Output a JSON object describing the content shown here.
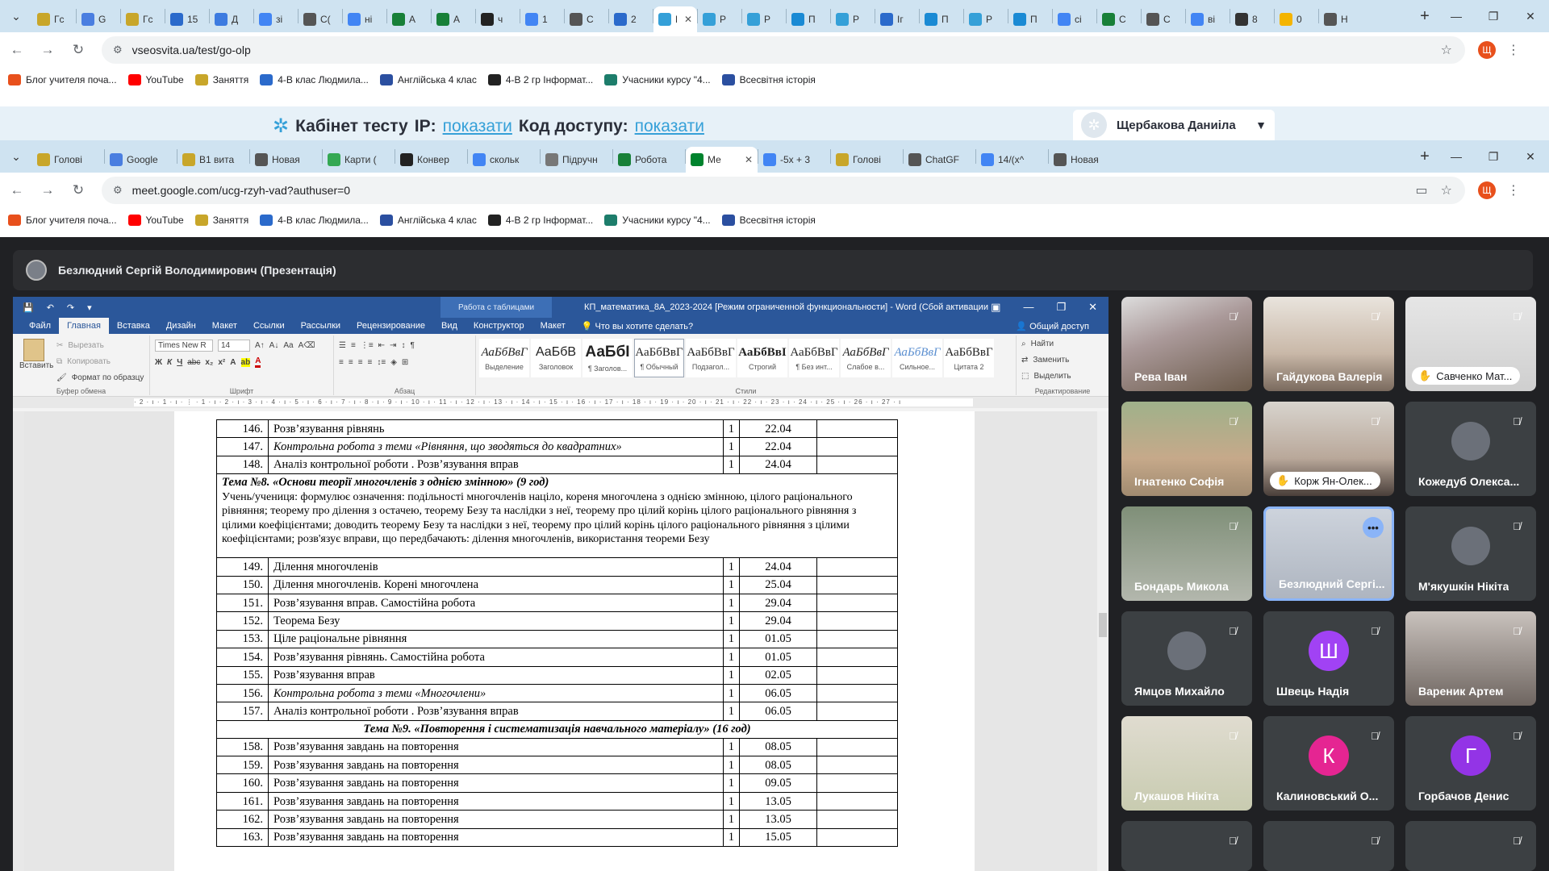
{
  "browser1": {
    "tabs": [
      {
        "label": "Гс",
        "color": "#c8a62a"
      },
      {
        "label": "G",
        "color": "#4a7ee0"
      },
      {
        "label": "Гс",
        "color": "#c8a62a"
      },
      {
        "label": "15",
        "color": "#2b6acb"
      },
      {
        "label": "Д",
        "color": "#3d7be0"
      },
      {
        "label": "зі",
        "color": "#4285f4"
      },
      {
        "label": "C(",
        "color": "#555"
      },
      {
        "label": "ні",
        "color": "#4285f4"
      },
      {
        "label": "А",
        "color": "#188038"
      },
      {
        "label": "А",
        "color": "#188038"
      },
      {
        "label": "ч",
        "color": "#222"
      },
      {
        "label": "1",
        "color": "#4285f4"
      },
      {
        "label": "C",
        "color": "#555"
      },
      {
        "label": "2",
        "color": "#2b6acb"
      },
      {
        "label": "П",
        "color": "#35a0d8",
        "active": true
      },
      {
        "label": "Р",
        "color": "#35a0d8"
      },
      {
        "label": "Р",
        "color": "#35a0d8"
      },
      {
        "label": "П",
        "color": "#1a8ad4"
      },
      {
        "label": "Р",
        "color": "#35a0d8"
      },
      {
        "label": "Іг",
        "color": "#2b6acb"
      },
      {
        "label": "П",
        "color": "#1a8ad4"
      },
      {
        "label": "Р",
        "color": "#35a0d8"
      },
      {
        "label": "П",
        "color": "#1a8ad4"
      },
      {
        "label": "сі",
        "color": "#4285f4"
      },
      {
        "label": "С",
        "color": "#188038"
      },
      {
        "label": "С",
        "color": "#555"
      },
      {
        "label": "ві",
        "color": "#4285f4"
      },
      {
        "label": "8",
        "color": "#333"
      },
      {
        "label": "0",
        "color": "#f4b400"
      },
      {
        "label": "Н",
        "color": "#555"
      }
    ],
    "url": "vseosvita.ua/test/go-olp"
  },
  "bookmarks": [
    {
      "label": "Блог учителя поча...",
      "color": "#e8501c"
    },
    {
      "label": "YouTube",
      "color": "#ff0000"
    },
    {
      "label": "Заняття",
      "color": "#c8a62a"
    },
    {
      "label": "4-В клас Людмила...",
      "color": "#2b6acb"
    },
    {
      "label": "Англійська 4 клас",
      "color": "#2b4fa0"
    },
    {
      "label": "4-В 2 гр Інформат...",
      "color": "#222"
    },
    {
      "label": "Учасники курсу \"4...",
      "color": "#1d7d6b"
    },
    {
      "label": "Всесвітня історія",
      "color": "#2b4fa0"
    }
  ],
  "cabinet": {
    "title": "Кабінет тесту",
    "ip_label": "IP:",
    "ip_link": "показати",
    "code_label": "Код доступу:",
    "code_link": "показати",
    "user": "Щербакова Даниіла"
  },
  "browser2": {
    "tabs": [
      {
        "label": "Голові",
        "color": "#c8a62a"
      },
      {
        "label": "Google",
        "color": "#4a7ee0"
      },
      {
        "label": "В1 вита",
        "color": "#c8a62a"
      },
      {
        "label": "Новая",
        "color": "#555"
      },
      {
        "label": "Карти (",
        "color": "#34a853"
      },
      {
        "label": "Конвер",
        "color": "#222"
      },
      {
        "label": "скольк",
        "color": "#4285f4"
      },
      {
        "label": "Підручн",
        "color": "#777"
      },
      {
        "label": "Робота",
        "color": "#188038"
      },
      {
        "label": "Ме",
        "color": "#00832d",
        "active": true
      },
      {
        "label": "-5x + 3",
        "color": "#4285f4"
      },
      {
        "label": "Голові",
        "color": "#c8a62a"
      },
      {
        "label": "ChatGF",
        "color": "#555"
      },
      {
        "label": "14/(x^",
        "color": "#4285f4"
      },
      {
        "label": "Новая",
        "color": "#555"
      }
    ],
    "url": "meet.google.com/ucg-rzyh-vad?authuser=0"
  },
  "meet": {
    "presenter": "Безлюдний Сергій Володимирович (Презентація)"
  },
  "word": {
    "context_tab": "Работа с таблицами",
    "doc_title": "КП_математика_8А_2023-2024 [Режим ограниченной функциональности] - Word (Сбой активации п...",
    "tabs": [
      "Файл",
      "Главная",
      "Вставка",
      "Дизайн",
      "Макет",
      "Ссылки",
      "Рассылки",
      "Рецензирование",
      "Вид",
      "Конструктор",
      "Макет",
      "Что вы хотите сделать?"
    ],
    "share": "Общий доступ",
    "clipboard": {
      "paste": "Вставить",
      "cut": "Вырезать",
      "copy": "Копировать",
      "format": "Формат по образцу",
      "group": "Буфер обмена"
    },
    "font": {
      "name": "Times New R",
      "size": "14",
      "group": "Шрифт"
    },
    "paragraph_group": "Абзац",
    "styles": [
      {
        "preview": "АаБбВвГ",
        "name": "Выделение"
      },
      {
        "preview": "АаБбВ",
        "name": "Заголовок"
      },
      {
        "preview": "АаБбІ",
        "name": "¶ Заголов..."
      },
      {
        "preview": "АаБбВвГ",
        "name": "¶ Обычный"
      },
      {
        "preview": "АаБбВвГ",
        "name": "Подзагол..."
      },
      {
        "preview": "АаБбВвІ",
        "name": "Строгий"
      },
      {
        "preview": "АаБбВвГ",
        "name": "¶ Без инт..."
      },
      {
        "preview": "АаБбВвГ",
        "name": "Слабое в..."
      },
      {
        "preview": "АаБбВвГ",
        "name": "Сильное..."
      },
      {
        "preview": "АаБбВвГ",
        "name": "Цитата 2"
      }
    ],
    "styles_group": "Стили",
    "editing": {
      "find": "Найти",
      "replace": "Заменить",
      "select": "Выделить",
      "group": "Редактирование"
    },
    "ruler": "· 2 · ı · 1 · ı · ⋮ · 1 · ı · 2 · ı · 3 · ı · 4 · ı · 5 · ı · 6 · ı · 7 · ı · 8 · ı · 9 · ı · 10 · ı · 11 · ı · 12 · ı · 13 · ı · 14 · ı · 15 · ı · 16 · ı · 17 · ı · 18 · ı · 19 · ı · 20 · ı · 21 · ı · 22 · ı · 23 · ı · 24 · ı · 25 · ı · 26 · ı · 27 · ı"
  },
  "lessons_a": [
    {
      "n": "146.",
      "title": "Розв’язування рівнянь",
      "hours": "1",
      "date": "22.04",
      "italic": false
    },
    {
      "n": "147.",
      "title": "Контрольна робота з теми «Рівняння, що зводяться до квадратних»",
      "hours": "1",
      "date": "22.04",
      "italic": true
    },
    {
      "n": "148.",
      "title": "Аналіз контрольної роботи . Розв’язування вправ",
      "hours": "1",
      "date": "24.04",
      "italic": false
    }
  ],
  "topic8": {
    "title": "Тема №8. «Основи теорії многочленів з однією змінною» (9 год)",
    "description": "Учень/учениця: формулює означення: подільності многочленів націло, кореня многочлена з однією змінною, цілого раціонального рівняння; теорему про ділення з остачею, теорему Безу та наслідки з неї, теорему про цілий корінь цілого раціонального рівняння з цілими коефіцієнтами; доводить теорему Безу та наслідки з неї, теорему про цілий корінь цілого раціонального рівняння з цілими коефіцієнтами; розв'язує вправи, що передбачають: ділення многочленів, використання теореми Безу"
  },
  "lessons_b": [
    {
      "n": "149.",
      "title": "Ділення многочленів",
      "hours": "1",
      "date": "24.04",
      "italic": false
    },
    {
      "n": "150.",
      "title": "Ділення многочленів. Корені многочлена",
      "hours": "1",
      "date": "25.04",
      "italic": false
    },
    {
      "n": "151.",
      "title": "Розв’язування вправ.  Самостійна робота",
      "hours": "1",
      "date": "29.04",
      "italic": false
    },
    {
      "n": "152.",
      "title": "Теорема Безу",
      "hours": "1",
      "date": "29.04",
      "italic": false
    },
    {
      "n": "153.",
      "title": "Ціле раціональне рівняння",
      "hours": "1",
      "date": "01.05",
      "italic": false
    },
    {
      "n": "154.",
      "title": "Розв’язування рівнянь.  Самостійна робота",
      "hours": "1",
      "date": "01.05",
      "italic": false
    },
    {
      "n": "155.",
      "title": "Розв’язування вправ",
      "hours": "1",
      "date": "02.05",
      "italic": false
    },
    {
      "n": "156.",
      "title": "Контрольна робота з теми «Многочлени»",
      "hours": "1",
      "date": "06.05",
      "italic": true
    },
    {
      "n": "157.",
      "title": "Аналіз контрольної роботи . Розв’язування вправ",
      "hours": "1",
      "date": "06.05",
      "italic": false
    }
  ],
  "topic9": {
    "title": "Тема №9. «Повторення і систематизація навчального матеріалу» (16 год)"
  },
  "lessons_c": [
    {
      "n": "158.",
      "title": "Розв’язування завдань на повторення",
      "hours": "1",
      "date": "08.05",
      "italic": false
    },
    {
      "n": "159.",
      "title": "Розв’язування завдань на повторення",
      "hours": "1",
      "date": "08.05",
      "italic": false
    },
    {
      "n": "160.",
      "title": "Розв’язування завдань на повторення",
      "hours": "1",
      "date": "09.05",
      "italic": false
    },
    {
      "n": "161.",
      "title": "Розв’язування завдань на повторення",
      "hours": "1",
      "date": "13.05",
      "italic": false
    },
    {
      "n": "162.",
      "title": "Розв’язування завдань на повторення",
      "hours": "1",
      "date": "13.05",
      "italic": false
    },
    {
      "n": "163.",
      "title": "Розв’язування завдань на повторення",
      "hours": "1",
      "date": "15.05",
      "italic": false
    }
  ],
  "participants": [
    {
      "name": "Рева Іван",
      "kind": "video",
      "bg": "video1",
      "muted": true
    },
    {
      "name": "Гайдукова Валерія",
      "kind": "video",
      "bg": "video2",
      "muted": true
    },
    {
      "name": "Савченко Мат...",
      "kind": "video",
      "bg": "video3",
      "muted": true,
      "pill": true
    },
    {
      "name": "Ігнатенко Софія",
      "kind": "video",
      "bg": "video4",
      "muted": true
    },
    {
      "name": "Корж Ян-Олек...",
      "kind": "video",
      "bg": "video5",
      "muted": true,
      "pill": true
    },
    {
      "name": "Кожедуб Олекса...",
      "kind": "avatar",
      "muted": true
    },
    {
      "name": "Бондарь Микола",
      "kind": "video",
      "bg": "video6",
      "muted": true
    },
    {
      "name": "Безлюдний Сергі...",
      "kind": "video",
      "bg": "video7",
      "muted": false,
      "selected": true
    },
    {
      "name": "М'якушкін Нікіта",
      "kind": "avatar",
      "muted": true
    },
    {
      "name": "Ямцов Михайло",
      "kind": "avatar",
      "muted": true
    },
    {
      "name": "Швець Надія",
      "kind": "letter",
      "letter": "Ш",
      "color": "#a142f4",
      "muted": true
    },
    {
      "name": "Вареник Артем",
      "kind": "video",
      "bg": "video8",
      "muted": true
    },
    {
      "name": "Лукашов Нікіта",
      "kind": "video",
      "bg": "video9",
      "muted": true
    },
    {
      "name": "Калиновський О...",
      "kind": "letter",
      "letter": "К",
      "color": "#e52592",
      "muted": true
    },
    {
      "name": "Горбачов Денис",
      "kind": "letter",
      "letter": "Г",
      "color": "#9334e6",
      "muted": true
    }
  ]
}
